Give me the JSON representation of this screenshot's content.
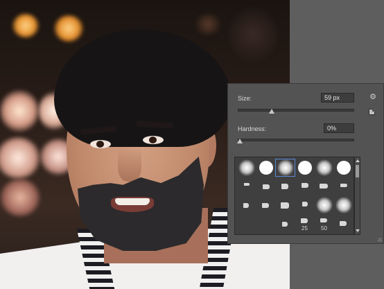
{
  "brush_panel": {
    "size_label": "Size:",
    "size_value": "59 px",
    "size_level_percent": 29,
    "hardness_label": "Hardness:",
    "hardness_value": "0%",
    "hardness_level_percent": 0,
    "settings_icon": "gear-icon",
    "new_preset_icon": "new-preset-icon",
    "resize_icon": "resize-grip-icon",
    "presets": [
      {
        "kind": "soft-round"
      },
      {
        "kind": "hard-round"
      },
      {
        "kind": "soft-round",
        "selected": true
      },
      {
        "kind": "hard-round"
      },
      {
        "kind": "soft-round"
      },
      {
        "kind": "hard-round"
      },
      {
        "kind": "tip-1"
      },
      {
        "kind": "tip-2"
      },
      {
        "kind": "tip-3"
      },
      {
        "kind": "tip-4"
      },
      {
        "kind": "tip-5"
      },
      {
        "kind": "tip-6"
      },
      {
        "kind": "tip-7"
      },
      {
        "kind": "tip-8"
      },
      {
        "kind": "tip-9"
      },
      {
        "kind": "tip-10"
      },
      {
        "kind": "soft-round"
      },
      {
        "kind": "soft-round"
      },
      {
        "kind": "tip-11"
      },
      {
        "kind": "tip-12"
      },
      {
        "kind": "tip-13"
      },
      {
        "kind": "tip-14",
        "label": "25"
      },
      {
        "kind": "tip-15",
        "label": "50"
      },
      {
        "kind": "tip-16"
      }
    ]
  },
  "colors": {
    "panel_bg": "#535353",
    "field_bg": "#3d3d3d",
    "selection_outline": "#5b8ad6",
    "beard_paint": "#2c2a2c"
  }
}
